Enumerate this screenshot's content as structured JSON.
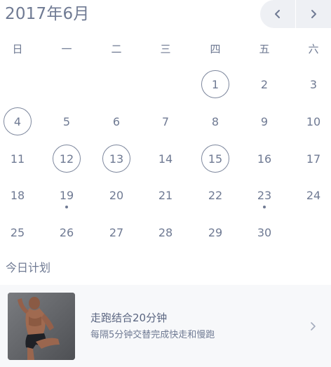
{
  "header": {
    "month_title": "2017年6月"
  },
  "nav": {
    "prev_icon": "chevron-left-icon",
    "next_icon": "chevron-right-icon"
  },
  "weekdays": [
    "日",
    "一",
    "二",
    "三",
    "四",
    "五",
    "六"
  ],
  "days": [
    {
      "label": "1",
      "circled": true,
      "dot": false,
      "weekday_index": 4,
      "week": 0
    },
    {
      "label": "2",
      "circled": false,
      "dot": false,
      "weekday_index": 5,
      "week": 0
    },
    {
      "label": "3",
      "circled": false,
      "dot": false,
      "weekday_index": 6,
      "week": 0
    },
    {
      "label": "4",
      "circled": true,
      "dot": false,
      "weekday_index": 0,
      "week": 1
    },
    {
      "label": "5",
      "circled": false,
      "dot": false,
      "weekday_index": 1,
      "week": 1
    },
    {
      "label": "6",
      "circled": false,
      "dot": false,
      "weekday_index": 2,
      "week": 1
    },
    {
      "label": "7",
      "circled": false,
      "dot": false,
      "weekday_index": 3,
      "week": 1
    },
    {
      "label": "8",
      "circled": false,
      "dot": false,
      "weekday_index": 4,
      "week": 1
    },
    {
      "label": "9",
      "circled": false,
      "dot": false,
      "weekday_index": 5,
      "week": 1
    },
    {
      "label": "10",
      "circled": false,
      "dot": false,
      "weekday_index": 6,
      "week": 1
    },
    {
      "label": "11",
      "circled": false,
      "dot": false,
      "weekday_index": 0,
      "week": 2
    },
    {
      "label": "12",
      "circled": true,
      "dot": false,
      "weekday_index": 1,
      "week": 2
    },
    {
      "label": "13",
      "circled": true,
      "dot": false,
      "weekday_index": 2,
      "week": 2
    },
    {
      "label": "14",
      "circled": false,
      "dot": false,
      "weekday_index": 3,
      "week": 2
    },
    {
      "label": "15",
      "circled": true,
      "dot": false,
      "weekday_index": 4,
      "week": 2
    },
    {
      "label": "16",
      "circled": false,
      "dot": false,
      "weekday_index": 5,
      "week": 2
    },
    {
      "label": "17",
      "circled": false,
      "dot": false,
      "weekday_index": 6,
      "week": 2
    },
    {
      "label": "18",
      "circled": false,
      "dot": false,
      "weekday_index": 0,
      "week": 3
    },
    {
      "label": "19",
      "circled": false,
      "dot": true,
      "weekday_index": 1,
      "week": 3
    },
    {
      "label": "20",
      "circled": false,
      "dot": false,
      "weekday_index": 2,
      "week": 3
    },
    {
      "label": "21",
      "circled": false,
      "dot": false,
      "weekday_index": 3,
      "week": 3
    },
    {
      "label": "22",
      "circled": false,
      "dot": false,
      "weekday_index": 4,
      "week": 3
    },
    {
      "label": "23",
      "circled": false,
      "dot": true,
      "weekday_index": 5,
      "week": 3
    },
    {
      "label": "24",
      "circled": false,
      "dot": false,
      "weekday_index": 6,
      "week": 3
    },
    {
      "label": "25",
      "circled": false,
      "dot": false,
      "weekday_index": 0,
      "week": 4
    },
    {
      "label": "26",
      "circled": false,
      "dot": false,
      "weekday_index": 1,
      "week": 4
    },
    {
      "label": "27",
      "circled": false,
      "dot": false,
      "weekday_index": 2,
      "week": 4
    },
    {
      "label": "28",
      "circled": false,
      "dot": false,
      "weekday_index": 3,
      "week": 4
    },
    {
      "label": "29",
      "circled": false,
      "dot": false,
      "weekday_index": 4,
      "week": 4
    },
    {
      "label": "30",
      "circled": false,
      "dot": false,
      "weekday_index": 5,
      "week": 4
    }
  ],
  "plan": {
    "section_title": "今日计划",
    "name": "走跑结合20分钟",
    "description": "每隔5分钟交替完成快走和慢跑",
    "thumbnail_icon": "runner-photo",
    "chevron_icon": "chevron-right-icon"
  },
  "colors": {
    "text": "#6f7a93",
    "nav_bg": "#eef0f4",
    "card_bg": "#f7f8fa",
    "circle_border": "#7d879d"
  }
}
